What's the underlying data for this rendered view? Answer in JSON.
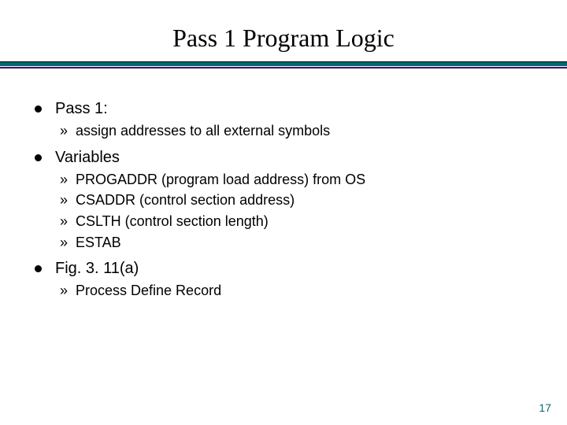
{
  "title": "Pass 1 Program Logic",
  "items": [
    {
      "label": "Pass 1:",
      "sub": [
        "assign addresses to all external symbols"
      ]
    },
    {
      "label": "Variables",
      "sub": [
        "PROGADDR (program load address) from OS",
        "CSADDR (control section address)",
        "CSLTH (control section length)",
        "ESTAB"
      ]
    },
    {
      "label": "Fig. 3. 11(a)",
      "sub": [
        "Process Define Record"
      ]
    }
  ],
  "page_number": "17"
}
